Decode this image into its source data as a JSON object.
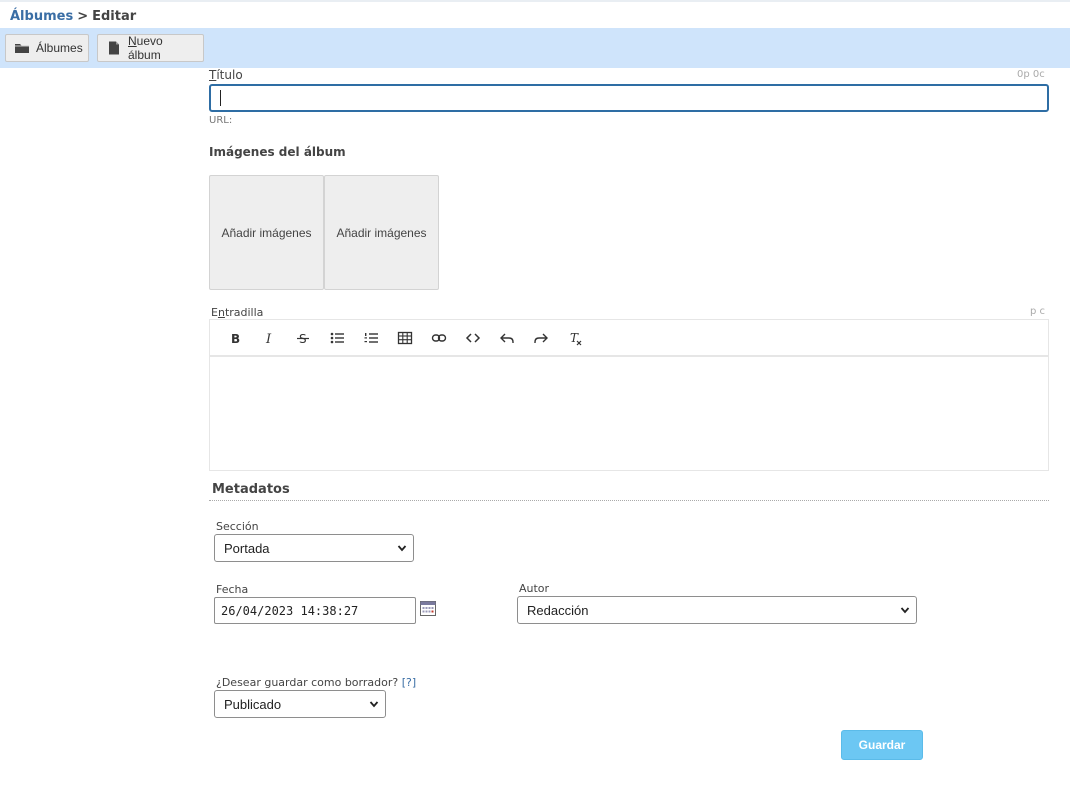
{
  "breadcrumb": {
    "parent": "Álbumes",
    "separator": ">",
    "current": "Editar"
  },
  "toolbar": {
    "albums_label": "Álbumes",
    "new_album_label_initial": "N",
    "new_album_label_rest": "uevo álbum"
  },
  "form": {
    "title_label_initial": "T",
    "title_label_rest": "ítulo",
    "title_value": "",
    "title_counter": "0p 0c",
    "url_label": "URL:",
    "images_heading": "Imágenes del álbum",
    "image_slots": [
      "Añadir imágenes",
      "Añadir imágenes"
    ],
    "summary_label_prefix": "E",
    "summary_label_initial": "n",
    "summary_label_rest": "tradilla",
    "summary_counter": "p c"
  },
  "editor_tools": [
    "bold",
    "italic",
    "strikethrough",
    "bullet-list",
    "numbered-list",
    "table",
    "link",
    "code",
    "undo",
    "redo",
    "clear-format"
  ],
  "metadata": {
    "heading": "Metadatos",
    "section_label": "Sección",
    "section_value": "Portada",
    "date_label": "Fecha",
    "date_value": "26/04/2023 14:38:27",
    "author_label": "Autor",
    "author_value": "Redacción",
    "draft_question": "¿Desear guardar como borrador?",
    "draft_help": "[?]",
    "draft_value": "Publicado"
  },
  "actions": {
    "save_label": "Guardar"
  },
  "colors": {
    "toolbar_bg": "#cfe4fb",
    "link": "#3a6ea5",
    "save_button": "#6cc7f3",
    "focus_border": "#2e6da4"
  }
}
